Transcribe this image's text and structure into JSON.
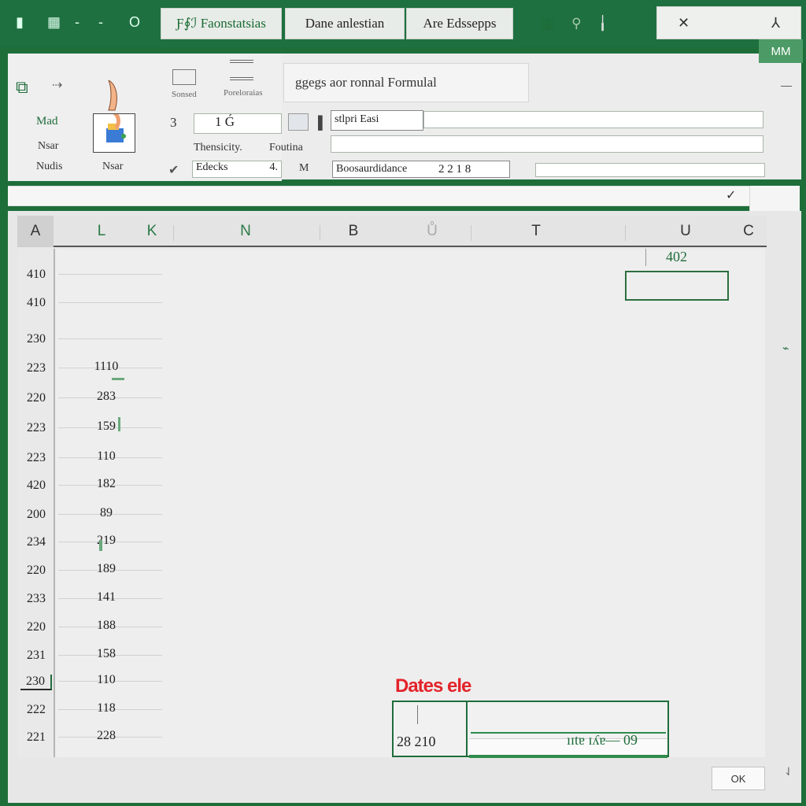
{
  "topbar": {
    "quick_access": [
      "▮",
      "▦",
      "-",
      "-",
      "O"
    ],
    "tabs": [
      "Ƒ∮ℐ Faonstatsias",
      "Dane anlestian",
      "Are  Edssepps"
    ],
    "tab_icons": [
      "▥",
      "⚲",
      "╽"
    ],
    "window_controls": [
      "✕",
      "⅄"
    ]
  },
  "ribbon": {
    "left": {
      "icon_labels": [
        "Mad",
        "Nsar",
        "Nudis"
      ],
      "paste_label": "Nsar",
      "btn1": "Sonsed",
      "btn2": "Poreloraias",
      "row1_num": "3",
      "row1_field": "1 Ǵ",
      "row2_a": "Thensicity.",
      "row2_b": "Foutina",
      "row3_field": "Edecks",
      "row3_field_right": "4.",
      "row3_icon": "M"
    },
    "formula_tab": "ggegs aor ronnal Formulal",
    "name_box_1": "stlpri Easi",
    "name_box_3": "Boosaurdidance",
    "name_box_3_nums": "2  2  1 8",
    "mm_label": "MM"
  },
  "formula_bar": {
    "check_icon": "check-icon"
  },
  "columns": [
    "A",
    "L",
    "K",
    "N",
    "B",
    "Ů",
    "T",
    "U",
    "C"
  ],
  "rows": [
    {
      "num": "410",
      "val": ""
    },
    {
      "num": "410",
      "val": ""
    },
    {
      "num": "230",
      "val": ""
    },
    {
      "num": "223",
      "val": "1110"
    },
    {
      "num": "220",
      "val": "283"
    },
    {
      "num": "223",
      "val": "159"
    },
    {
      "num": "223",
      "val": "110"
    },
    {
      "num": "420",
      "val": "182"
    },
    {
      "num": "200",
      "val": "89"
    },
    {
      "num": "234",
      "val": "219"
    },
    {
      "num": "220",
      "val": "189"
    },
    {
      "num": "233",
      "val": "141"
    },
    {
      "num": "220",
      "val": "188"
    },
    {
      "num": "231",
      "val": "158"
    },
    {
      "num": "230",
      "val": "110"
    },
    {
      "num": "222",
      "val": "118"
    },
    {
      "num": "221",
      "val": "228"
    }
  ],
  "selected_cell_value": "402",
  "date_section": {
    "label": "Dates ele",
    "cell_value": "28 210",
    "status_text": "ıɪtɐ  ɪʎɐ— 09"
  },
  "ok_button": "OK",
  "colors": {
    "accent_green": "#1f7040",
    "selection": "#2c6f3f",
    "date_label_red": "#e3232a"
  }
}
